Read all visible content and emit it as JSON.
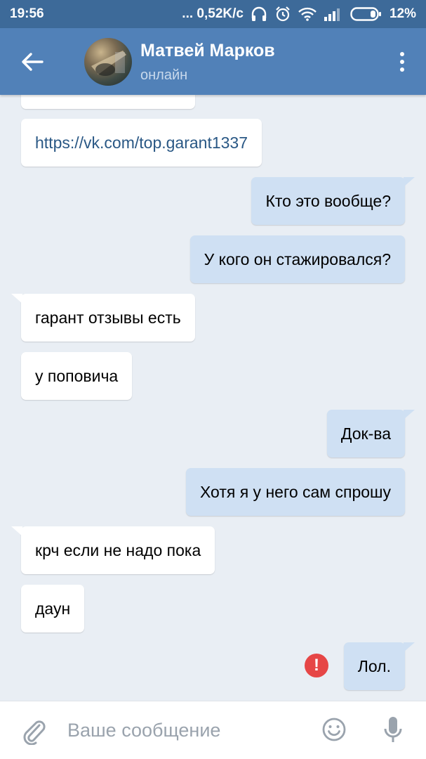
{
  "status_bar": {
    "time": "19:56",
    "network_speed": "... 0,52K/c",
    "battery": "12%",
    "icons": [
      "headphones-icon",
      "alarm-icon",
      "wifi-icon",
      "signal-icon",
      "battery-icon"
    ]
  },
  "header": {
    "back_icon": "arrow-left-icon",
    "contact_name": "Матвей Марков",
    "contact_status": "онлайн",
    "menu_icon": "more-vertical-icon"
  },
  "messages": [
    {
      "direction": "in",
      "text": ""
    },
    {
      "direction": "in",
      "text": "https://vk.com/top.garant1337",
      "is_link": true
    },
    {
      "direction": "out",
      "text": "Кто это вообще?"
    },
    {
      "direction": "out",
      "text": "У кого он стажировался?"
    },
    {
      "direction": "in",
      "text": "гарант отзывы есть"
    },
    {
      "direction": "in",
      "text": "у поповича"
    },
    {
      "direction": "out",
      "text": "Док-ва"
    },
    {
      "direction": "out",
      "text": "Хотя я у него сам спрошу"
    },
    {
      "direction": "in",
      "text": "крч если не надо пока"
    },
    {
      "direction": "in",
      "text": "даун"
    },
    {
      "direction": "out",
      "text": "Лол.",
      "error": true
    }
  ],
  "error_icon_glyph": "!",
  "input_bar": {
    "placeholder": "Ваше сообщение",
    "icons": [
      "paperclip-icon",
      "emoji-icon",
      "microphone-icon"
    ]
  },
  "colors": {
    "status_bar_bg": "#3d6a99",
    "header_bg": "#5181b8",
    "chat_bg": "#e9eef4",
    "bubble_in": "#ffffff",
    "bubble_out": "#cfe0f3",
    "link": "#2a5885",
    "error": "#e64646"
  }
}
